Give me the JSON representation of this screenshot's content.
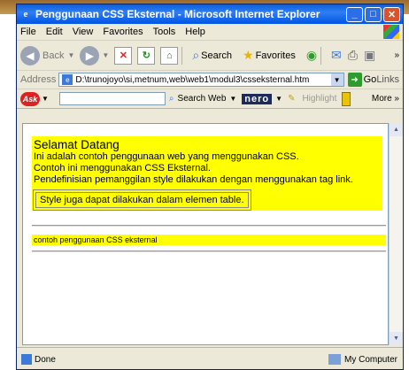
{
  "window": {
    "title": "Penggunaan CSS Eksternal - Microsoft Internet Explorer",
    "buttons": {
      "minimize": "_",
      "maximize": "□",
      "close": "✕"
    }
  },
  "menu": [
    "File",
    "Edit",
    "View",
    "Favorites",
    "Tools",
    "Help"
  ],
  "toolbar": {
    "back": "Back",
    "search": "Search",
    "favorites": "Favorites"
  },
  "address": {
    "label": "Address",
    "value": "D:\\trunojoyo\\si,metnum,web\\web1\\modul3\\csseksternal.htm",
    "go": "Go",
    "links": "Links"
  },
  "ask_toolbar": {
    "search_web": "Search Web",
    "nero": "nero",
    "highlight": "Highlight",
    "more": "More"
  },
  "page": {
    "heading": "Selamat Datang",
    "lines": [
      "Ini adalah contoh penggunaan web yang menggunakan CSS.",
      "Contoh ini menggunakan CSS Eksternal.",
      "Pendefinisian pemanggilan style dilakukan dengan menggunakan tag link."
    ],
    "table_cell": "Style juga dapat dilakukan dalam elemen table.",
    "footer_line": "contoh penggunaan CSS eksternal"
  },
  "status": {
    "left": "Done",
    "zone": "My Computer"
  },
  "colors": {
    "highlight": "#ffff00",
    "titlebar": "#0054e3"
  }
}
